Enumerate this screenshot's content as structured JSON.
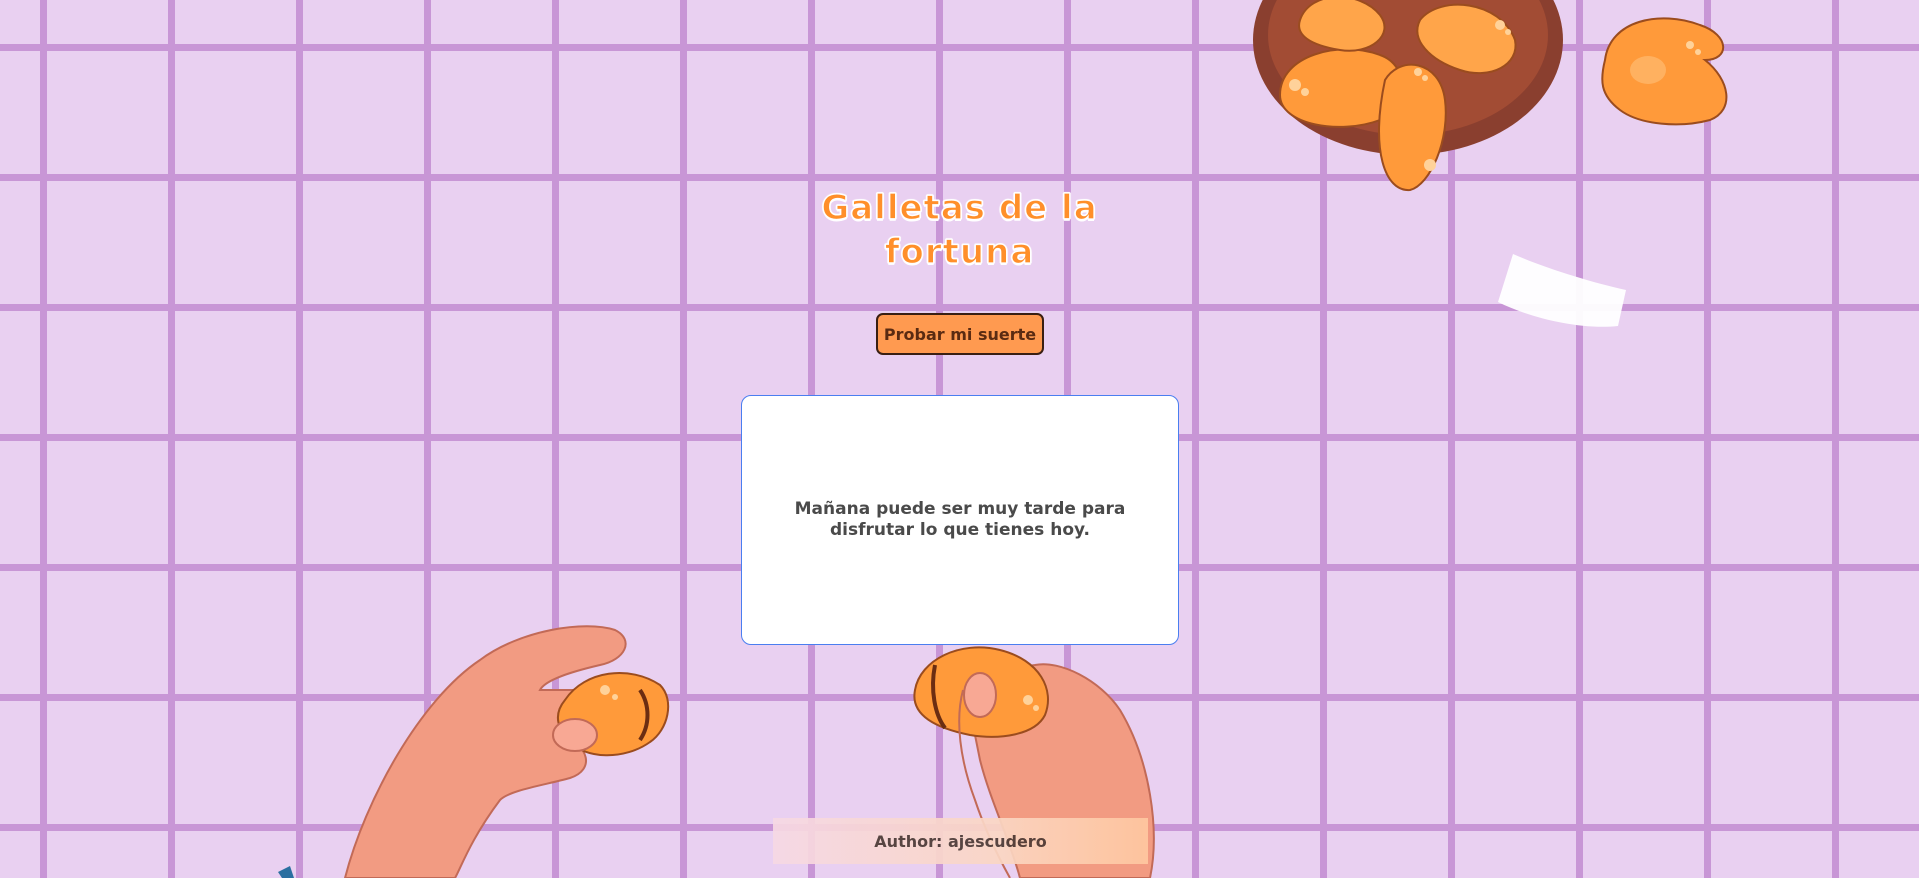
{
  "page": {
    "title": "Galletas de la fortuna"
  },
  "actions": {
    "try_luck_label": "Probar mi suerte"
  },
  "fortune": {
    "message": "Mañana puede ser muy tarde para disfrutar lo que tienes hoy."
  },
  "footer": {
    "author_text": "Author: ajescudero"
  },
  "colors": {
    "background": "#e9d0f1",
    "grid_lines": "#c896d6",
    "accent_orange": "#ff8f2a",
    "button_fill": "#ff9a50",
    "card_border": "#4a7ef0"
  },
  "icons": {
    "cookie_bowl": "fortune-cookie-bowl-icon",
    "single_cookie": "fortune-cookie-icon",
    "paper_slip": "paper-slip-icon",
    "hands": "hands-breaking-cookie-icon"
  }
}
